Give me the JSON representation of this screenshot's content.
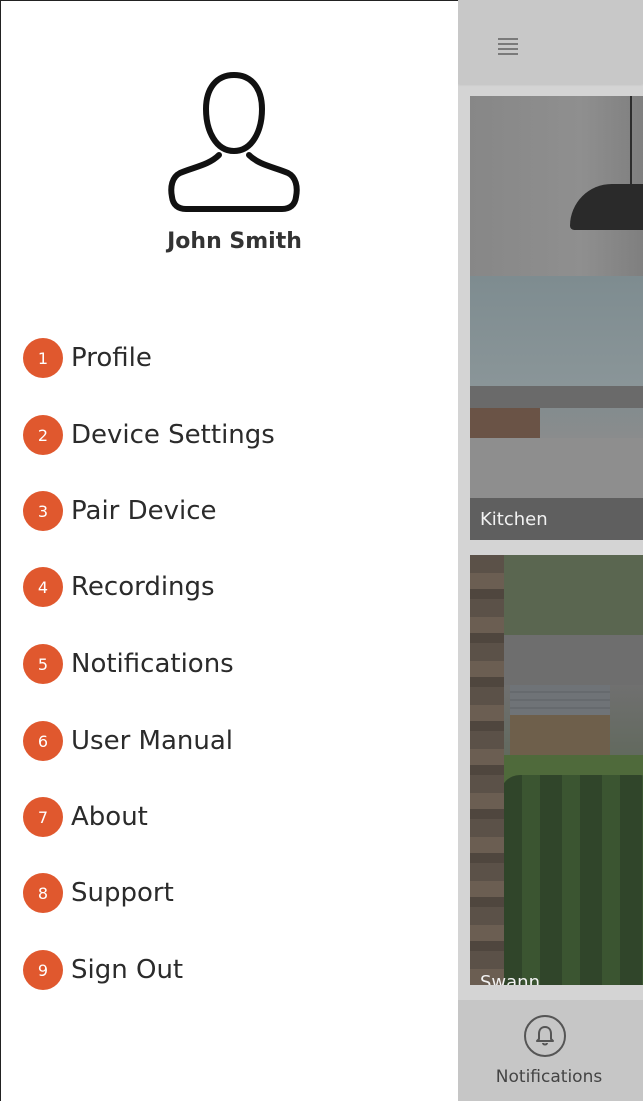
{
  "user": {
    "name": "John Smith"
  },
  "menu": {
    "items": [
      {
        "number": "1",
        "label": "Profile"
      },
      {
        "number": "2",
        "label": "Device Settings"
      },
      {
        "number": "3",
        "label": "Pair Device"
      },
      {
        "number": "4",
        "label": "Recordings"
      },
      {
        "number": "5",
        "label": "Notifications"
      },
      {
        "number": "6",
        "label": "User Manual"
      },
      {
        "number": "7",
        "label": "About"
      },
      {
        "number": "8",
        "label": "Support"
      },
      {
        "number": "9",
        "label": "Sign Out"
      }
    ]
  },
  "cameras": [
    {
      "label": "Kitchen"
    },
    {
      "label": "Swann"
    }
  ],
  "bottom_nav": {
    "notifications_label": "Notifications"
  },
  "icons": {
    "menu": "hamburger-icon",
    "avatar": "user-avatar-icon",
    "bell": "bell-icon"
  },
  "colors": {
    "badge": "#e0582e",
    "overlay": "#d4d4d4"
  }
}
